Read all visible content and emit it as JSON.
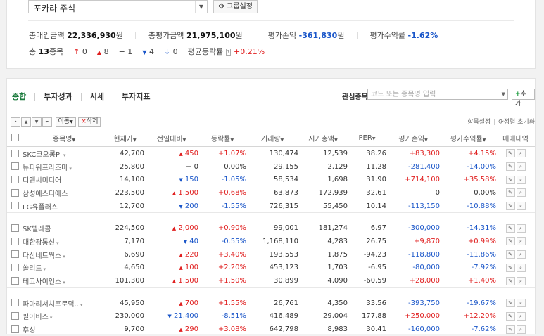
{
  "portfolio": {
    "selected": "포카라 주식",
    "group_button": "그룹설정"
  },
  "summary": {
    "buy_label": "총매입금액",
    "buy_value": "22,336,930",
    "buy_unit": "원",
    "eval_label": "총평가금액",
    "eval_value": "21,975,100",
    "eval_unit": "원",
    "pl_label": "평가손익",
    "pl_value": "-361,830",
    "pl_unit": "원",
    "ret_label": "평가수익률",
    "ret_value": "-1.62%",
    "count_prefix": "총",
    "count_value": "13",
    "count_suffix": "종목",
    "upper_limit": "0",
    "up": "8",
    "flat": "1",
    "down": "4",
    "lower_limit": "0",
    "avg_label": "평균등락률",
    "avg_value": "+0.21%"
  },
  "tabs": [
    "종합",
    "투자성과",
    "시세",
    "투자지표"
  ],
  "favorite": {
    "label": "관심종목",
    "placeholder": "코드 또는 종목명 입력",
    "add_label": "추가"
  },
  "toolbar": {
    "move_label": "이동",
    "delete_label": "삭제",
    "settings_link": "항목설정",
    "reset_link": "정렬 초기화"
  },
  "columns": [
    "종목명",
    "현재가",
    "전일대비",
    "등락률",
    "거래량",
    "시가총액",
    "PER",
    "평가손익",
    "평가수익률",
    "매매내역"
  ],
  "rows": [
    {
      "name": "SKC코오롱PI",
      "price": "42,700",
      "dir": "up",
      "change": "450",
      "rate": "+1.07%",
      "volume": "130,474",
      "cap": "12,539",
      "per": "38.26",
      "pl": "+83,300",
      "ret": "+4.15%"
    },
    {
      "name": "뉴파워프라즈마",
      "price": "25,800",
      "dir": "flat",
      "change": "0",
      "rate": "0.00%",
      "volume": "29,155",
      "cap": "2,129",
      "per": "11.28",
      "pl": "-281,400",
      "ret": "-14.00%"
    },
    {
      "name": "디앤씨미디어",
      "price": "14,100",
      "dir": "down",
      "change": "150",
      "rate": "-1.05%",
      "volume": "58,534",
      "cap": "1,698",
      "per": "31.90",
      "pl": "+714,100",
      "ret": "+35.58%"
    },
    {
      "name": "삼성에스디에스",
      "price": "223,500",
      "dir": "up",
      "change": "1,500",
      "rate": "+0.68%",
      "volume": "63,873",
      "cap": "172,939",
      "per": "32.61",
      "pl": "0",
      "ret": "0.00%"
    },
    {
      "name": "LG유플러스",
      "price": "12,700",
      "dir": "down",
      "change": "200",
      "rate": "-1.55%",
      "volume": "726,315",
      "cap": "55,450",
      "per": "10.14",
      "pl": "-113,150",
      "ret": "-10.88%"
    },
    {
      "name": "SK텔레콤",
      "price": "224,500",
      "dir": "up",
      "change": "2,000",
      "rate": "+0.90%",
      "volume": "99,001",
      "cap": "181,274",
      "per": "6.97",
      "pl": "-300,000",
      "ret": "-14.31%"
    },
    {
      "name": "대한광통신",
      "price": "7,170",
      "dir": "down",
      "change": "40",
      "rate": "-0.55%",
      "volume": "1,168,110",
      "cap": "4,283",
      "per": "26.75",
      "pl": "+9,870",
      "ret": "+0.99%"
    },
    {
      "name": "다산네트웍스",
      "price": "6,690",
      "dir": "up",
      "change": "220",
      "rate": "+3.40%",
      "volume": "193,553",
      "cap": "1,875",
      "per": "-94.23",
      "pl": "-118,800",
      "ret": "-11.86%"
    },
    {
      "name": "쏠리드",
      "price": "4,650",
      "dir": "up",
      "change": "100",
      "rate": "+2.20%",
      "volume": "453,123",
      "cap": "1,703",
      "per": "-6.95",
      "pl": "-80,000",
      "ret": "-7.92%"
    },
    {
      "name": "테고사이언스",
      "price": "101,300",
      "dir": "up",
      "change": "1,500",
      "rate": "+1.50%",
      "volume": "30,899",
      "cap": "4,090",
      "per": "-60.59",
      "pl": "+28,000",
      "ret": "+1.40%"
    },
    {
      "name": "파마리서치프로덕..",
      "price": "45,950",
      "dir": "up",
      "change": "700",
      "rate": "+1.55%",
      "volume": "26,761",
      "cap": "4,350",
      "per": "33.56",
      "pl": "-393,750",
      "ret": "-19.67%"
    },
    {
      "name": "필어비스",
      "price": "230,000",
      "dir": "down",
      "change": "21,400",
      "rate": "-8.51%",
      "volume": "416,489",
      "cap": "29,004",
      "per": "177.88",
      "pl": "+250,000",
      "ret": "+12.20%"
    },
    {
      "name": "후성",
      "price": "9,700",
      "dir": "up",
      "change": "290",
      "rate": "+3.08%",
      "volume": "642,798",
      "cap": "8,983",
      "per": "30.41",
      "pl": "-160,000",
      "ret": "-7.62%"
    }
  ],
  "colors": {
    "up": "#e02020",
    "down": "#1a56c9",
    "active_tab": "#1a7a3c"
  }
}
